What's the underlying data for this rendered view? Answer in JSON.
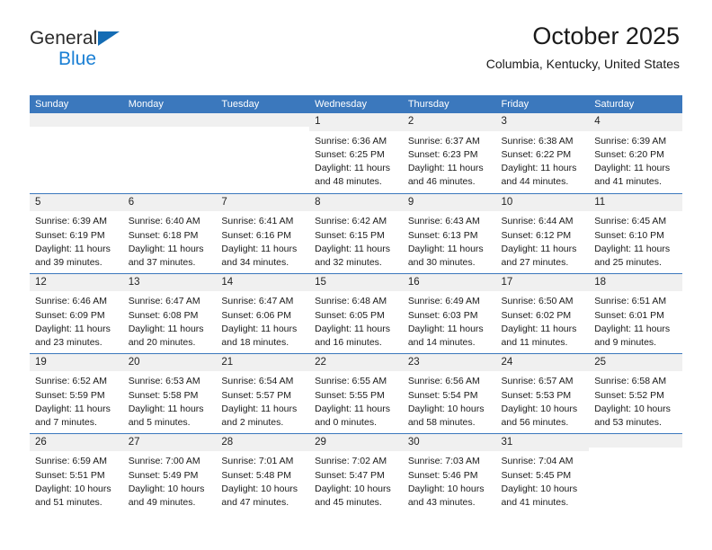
{
  "brand": {
    "name_top": "General",
    "name_bottom": "Blue",
    "triangle_color": "#146cb4",
    "blue_color": "#1a7fd4"
  },
  "header": {
    "title": "October 2025",
    "subtitle": "Columbia, Kentucky, United States"
  },
  "theme": {
    "header_bg": "#3b78bd",
    "header_text": "#ffffff",
    "daynum_bg": "#f0f0f0",
    "cell_bg": "#ffffff",
    "separator": "#3b78bd"
  },
  "weekday_headers": [
    "Sunday",
    "Monday",
    "Tuesday",
    "Wednesday",
    "Thursday",
    "Friday",
    "Saturday"
  ],
  "weeks": [
    [
      {
        "day": "",
        "sunrise": "",
        "sunset": "",
        "daylight_line1": "",
        "daylight_line2": "",
        "empty": true
      },
      {
        "day": "",
        "sunrise": "",
        "sunset": "",
        "daylight_line1": "",
        "daylight_line2": "",
        "empty": true
      },
      {
        "day": "",
        "sunrise": "",
        "sunset": "",
        "daylight_line1": "",
        "daylight_line2": "",
        "empty": true
      },
      {
        "day": "1",
        "sunrise": "Sunrise: 6:36 AM",
        "sunset": "Sunset: 6:25 PM",
        "daylight_line1": "Daylight: 11 hours",
        "daylight_line2": "and 48 minutes."
      },
      {
        "day": "2",
        "sunrise": "Sunrise: 6:37 AM",
        "sunset": "Sunset: 6:23 PM",
        "daylight_line1": "Daylight: 11 hours",
        "daylight_line2": "and 46 minutes."
      },
      {
        "day": "3",
        "sunrise": "Sunrise: 6:38 AM",
        "sunset": "Sunset: 6:22 PM",
        "daylight_line1": "Daylight: 11 hours",
        "daylight_line2": "and 44 minutes."
      },
      {
        "day": "4",
        "sunrise": "Sunrise: 6:39 AM",
        "sunset": "Sunset: 6:20 PM",
        "daylight_line1": "Daylight: 11 hours",
        "daylight_line2": "and 41 minutes."
      }
    ],
    [
      {
        "day": "5",
        "sunrise": "Sunrise: 6:39 AM",
        "sunset": "Sunset: 6:19 PM",
        "daylight_line1": "Daylight: 11 hours",
        "daylight_line2": "and 39 minutes."
      },
      {
        "day": "6",
        "sunrise": "Sunrise: 6:40 AM",
        "sunset": "Sunset: 6:18 PM",
        "daylight_line1": "Daylight: 11 hours",
        "daylight_line2": "and 37 minutes."
      },
      {
        "day": "7",
        "sunrise": "Sunrise: 6:41 AM",
        "sunset": "Sunset: 6:16 PM",
        "daylight_line1": "Daylight: 11 hours",
        "daylight_line2": "and 34 minutes."
      },
      {
        "day": "8",
        "sunrise": "Sunrise: 6:42 AM",
        "sunset": "Sunset: 6:15 PM",
        "daylight_line1": "Daylight: 11 hours",
        "daylight_line2": "and 32 minutes."
      },
      {
        "day": "9",
        "sunrise": "Sunrise: 6:43 AM",
        "sunset": "Sunset: 6:13 PM",
        "daylight_line1": "Daylight: 11 hours",
        "daylight_line2": "and 30 minutes."
      },
      {
        "day": "10",
        "sunrise": "Sunrise: 6:44 AM",
        "sunset": "Sunset: 6:12 PM",
        "daylight_line1": "Daylight: 11 hours",
        "daylight_line2": "and 27 minutes."
      },
      {
        "day": "11",
        "sunrise": "Sunrise: 6:45 AM",
        "sunset": "Sunset: 6:10 PM",
        "daylight_line1": "Daylight: 11 hours",
        "daylight_line2": "and 25 minutes."
      }
    ],
    [
      {
        "day": "12",
        "sunrise": "Sunrise: 6:46 AM",
        "sunset": "Sunset: 6:09 PM",
        "daylight_line1": "Daylight: 11 hours",
        "daylight_line2": "and 23 minutes."
      },
      {
        "day": "13",
        "sunrise": "Sunrise: 6:47 AM",
        "sunset": "Sunset: 6:08 PM",
        "daylight_line1": "Daylight: 11 hours",
        "daylight_line2": "and 20 minutes."
      },
      {
        "day": "14",
        "sunrise": "Sunrise: 6:47 AM",
        "sunset": "Sunset: 6:06 PM",
        "daylight_line1": "Daylight: 11 hours",
        "daylight_line2": "and 18 minutes."
      },
      {
        "day": "15",
        "sunrise": "Sunrise: 6:48 AM",
        "sunset": "Sunset: 6:05 PM",
        "daylight_line1": "Daylight: 11 hours",
        "daylight_line2": "and 16 minutes."
      },
      {
        "day": "16",
        "sunrise": "Sunrise: 6:49 AM",
        "sunset": "Sunset: 6:03 PM",
        "daylight_line1": "Daylight: 11 hours",
        "daylight_line2": "and 14 minutes."
      },
      {
        "day": "17",
        "sunrise": "Sunrise: 6:50 AM",
        "sunset": "Sunset: 6:02 PM",
        "daylight_line1": "Daylight: 11 hours",
        "daylight_line2": "and 11 minutes."
      },
      {
        "day": "18",
        "sunrise": "Sunrise: 6:51 AM",
        "sunset": "Sunset: 6:01 PM",
        "daylight_line1": "Daylight: 11 hours",
        "daylight_line2": "and 9 minutes."
      }
    ],
    [
      {
        "day": "19",
        "sunrise": "Sunrise: 6:52 AM",
        "sunset": "Sunset: 5:59 PM",
        "daylight_line1": "Daylight: 11 hours",
        "daylight_line2": "and 7 minutes."
      },
      {
        "day": "20",
        "sunrise": "Sunrise: 6:53 AM",
        "sunset": "Sunset: 5:58 PM",
        "daylight_line1": "Daylight: 11 hours",
        "daylight_line2": "and 5 minutes."
      },
      {
        "day": "21",
        "sunrise": "Sunrise: 6:54 AM",
        "sunset": "Sunset: 5:57 PM",
        "daylight_line1": "Daylight: 11 hours",
        "daylight_line2": "and 2 minutes."
      },
      {
        "day": "22",
        "sunrise": "Sunrise: 6:55 AM",
        "sunset": "Sunset: 5:55 PM",
        "daylight_line1": "Daylight: 11 hours",
        "daylight_line2": "and 0 minutes."
      },
      {
        "day": "23",
        "sunrise": "Sunrise: 6:56 AM",
        "sunset": "Sunset: 5:54 PM",
        "daylight_line1": "Daylight: 10 hours",
        "daylight_line2": "and 58 minutes."
      },
      {
        "day": "24",
        "sunrise": "Sunrise: 6:57 AM",
        "sunset": "Sunset: 5:53 PM",
        "daylight_line1": "Daylight: 10 hours",
        "daylight_line2": "and 56 minutes."
      },
      {
        "day": "25",
        "sunrise": "Sunrise: 6:58 AM",
        "sunset": "Sunset: 5:52 PM",
        "daylight_line1": "Daylight: 10 hours",
        "daylight_line2": "and 53 minutes."
      }
    ],
    [
      {
        "day": "26",
        "sunrise": "Sunrise: 6:59 AM",
        "sunset": "Sunset: 5:51 PM",
        "daylight_line1": "Daylight: 10 hours",
        "daylight_line2": "and 51 minutes."
      },
      {
        "day": "27",
        "sunrise": "Sunrise: 7:00 AM",
        "sunset": "Sunset: 5:49 PM",
        "daylight_line1": "Daylight: 10 hours",
        "daylight_line2": "and 49 minutes."
      },
      {
        "day": "28",
        "sunrise": "Sunrise: 7:01 AM",
        "sunset": "Sunset: 5:48 PM",
        "daylight_line1": "Daylight: 10 hours",
        "daylight_line2": "and 47 minutes."
      },
      {
        "day": "29",
        "sunrise": "Sunrise: 7:02 AM",
        "sunset": "Sunset: 5:47 PM",
        "daylight_line1": "Daylight: 10 hours",
        "daylight_line2": "and 45 minutes."
      },
      {
        "day": "30",
        "sunrise": "Sunrise: 7:03 AM",
        "sunset": "Sunset: 5:46 PM",
        "daylight_line1": "Daylight: 10 hours",
        "daylight_line2": "and 43 minutes."
      },
      {
        "day": "31",
        "sunrise": "Sunrise: 7:04 AM",
        "sunset": "Sunset: 5:45 PM",
        "daylight_line1": "Daylight: 10 hours",
        "daylight_line2": "and 41 minutes."
      },
      {
        "day": "",
        "sunrise": "",
        "sunset": "",
        "daylight_line1": "",
        "daylight_line2": "",
        "empty": true
      }
    ]
  ]
}
